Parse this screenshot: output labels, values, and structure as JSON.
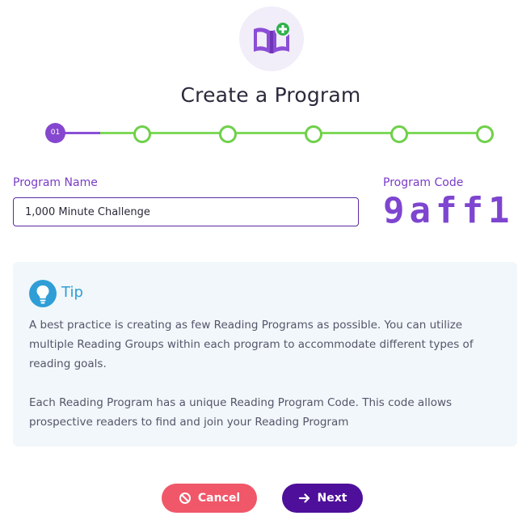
{
  "header": {
    "title": "Create a Program",
    "icon": "book-add-icon"
  },
  "stepper": {
    "current_step_label": "01",
    "current_step": 1,
    "total_steps": 6
  },
  "form": {
    "program_name_label": "Program Name",
    "program_name_value": "1,000 Minute Challenge",
    "program_code_label": "Program Code",
    "program_code_value": "9aff1"
  },
  "tip": {
    "title": "Tip",
    "icon": "lightbulb-icon",
    "paragraph1": "A best practice is creating as few Reading Programs as possible. You can utilize multiple Reading Groups within each program to accommodate different types of reading goals.",
    "paragraph2": "Each Reading Program has a unique Reading Program Code. This code allows prospective readers to find and join your Reading Program"
  },
  "actions": {
    "cancel_label": "Cancel",
    "cancel_icon": "ban-icon",
    "next_label": "Next",
    "next_icon": "arrow-right-icon"
  },
  "colors": {
    "brand_purple": "#8547cf",
    "step_green": "#6fd04a",
    "tip_blue": "#2f9ed6",
    "cancel_red": "#f05769",
    "next_purple": "#4e0f9a"
  }
}
